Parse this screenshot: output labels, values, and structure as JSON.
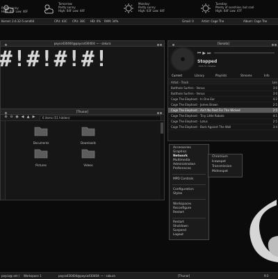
{
  "weather": [
    {
      "day": "Today:",
      "cond": "Partly sunny",
      "temps": "High: 61F  Low: 46F",
      "icon": "partly-sunny-icon"
    },
    {
      "day": "Tomorrow:",
      "cond": "Partly sunny",
      "temps": "High: 64F  Low: 44F",
      "icon": "partly-sunny-icon"
    },
    {
      "day": "Monday:",
      "cond": "Partly sunny",
      "temps": "High: 63F  Low: 44F",
      "icon": "sunny-icon"
    },
    {
      "day": "Tuesday:",
      "cond": "Plenty of sunshine, but cool",
      "temps": "High: 64F  Low: 47F",
      "icon": "sunny-icon"
    }
  ],
  "statusbar": {
    "kernel": "Kernel: 2.6.32-5-amd64",
    "cpu_temp": "CPU: 43C",
    "cpu": "CPU: 38C",
    "hd": "HD: 0%",
    "ram": "RAM: 34%",
    "gmail": "Gmail: 0",
    "artist": "Artist: Cage The",
    "album": "Album: Cage The"
  },
  "terminal": {
    "title": "payco430404@payco430404: ~ - sakura",
    "art": "#!#!#!#!"
  },
  "thunar": {
    "title": "[Thunar]",
    "path": "6 items (51 hidden)",
    "folders": [
      "Documents",
      "Downloads",
      "Pictures",
      "Videos"
    ]
  },
  "sonata": {
    "title": "[Sonata]",
    "status": "Stopped",
    "hint": "Click to collapse",
    "tabs": [
      "Current",
      "Library",
      "Playlists",
      "Streams",
      "Info"
    ],
    "header": {
      "title": "Artist - Track",
      "len": "Len"
    },
    "tracks": [
      {
        "t": "Butthole Surfers - Venus",
        "d": "3:0"
      },
      {
        "t": "Butthole Surfers - Venus",
        "d": "3:0"
      },
      {
        "t": "Cage The Elephant - In One Ear",
        "d": "4:2"
      },
      {
        "t": "Cage The Elephant - James Brown",
        "d": "2:5"
      },
      {
        "t": "Cage The Elephant - Ain't No Rest For The Wicked",
        "d": "2:5"
      },
      {
        "t": "Cage The Elephant - Tiny Little Robots",
        "d": "4:1"
      },
      {
        "t": "Cage The Elephant - Lotus",
        "d": "2:5"
      },
      {
        "t": "Cage The Elephant - Back Against The Wall",
        "d": "3:4"
      }
    ]
  },
  "menu": {
    "group1": [
      "Accessories",
      "Graphics",
      "Network",
      "Multimedia",
      "Administration",
      "Preferences"
    ],
    "group2": [
      "MPD Controls"
    ],
    "group3": [
      "Configuration",
      "Styles"
    ],
    "group4": [
      "Workspaces",
      "Reconfigure",
      "Restart"
    ],
    "group5": [
      "Restart",
      "Shutdown",
      "Suspend",
      "Logout"
    ]
  },
  "submenu": [
    "Chromium",
    "Icewepet",
    "Transmission",
    "Midnexpet"
  ],
  "taskbar": {
    "user": "payco@ am /",
    "workspace": "Workspace 1",
    "task1": "payco430404@payco430404: ~ - sakura",
    "task2": "[Thunar]",
    "time": "9:3"
  }
}
